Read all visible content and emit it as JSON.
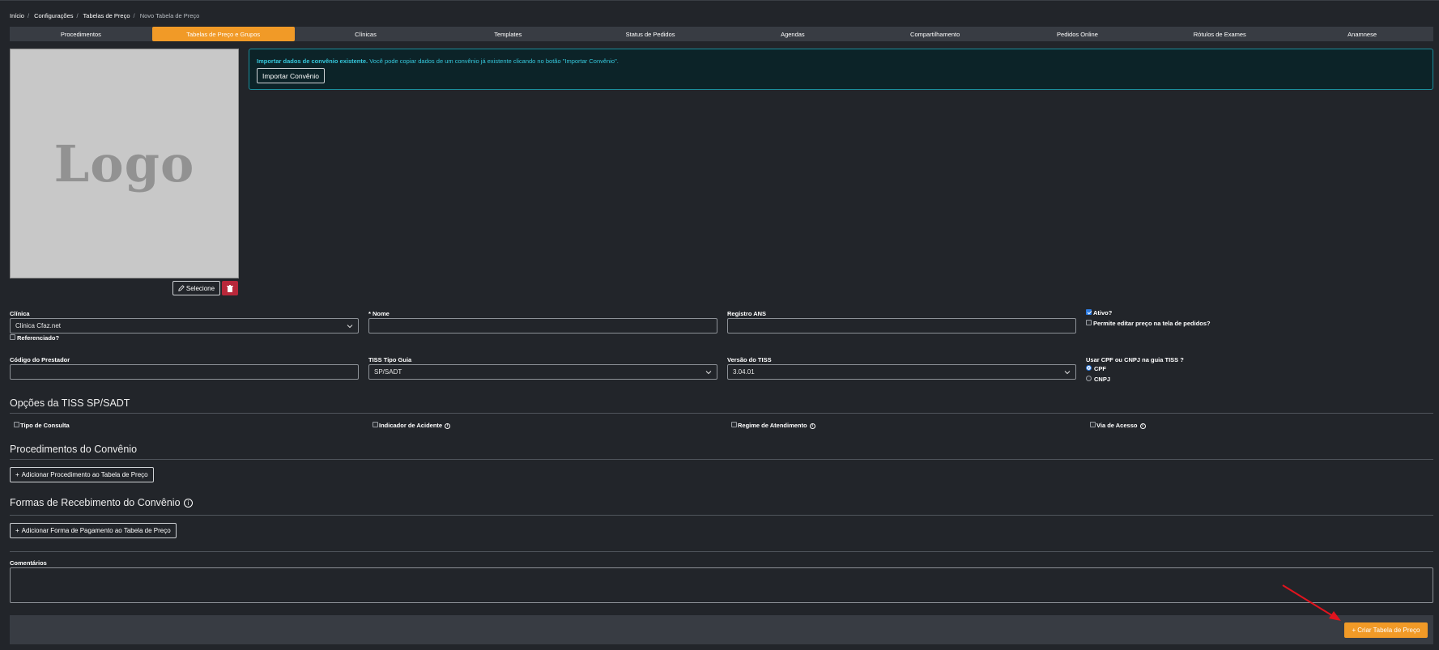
{
  "breadcrumb": {
    "items": [
      "Início",
      "Configurações",
      "Tabelas de Preço",
      "Novo Tabela de Preço"
    ]
  },
  "tabs": [
    {
      "label": "Procedimentos"
    },
    {
      "label": "Tabelas de Preço e Grupos"
    },
    {
      "label": "Clínicas"
    },
    {
      "label": "Templates"
    },
    {
      "label": "Status de Pedidos"
    },
    {
      "label": "Agendas"
    },
    {
      "label": "Compartilhamento"
    },
    {
      "label": "Pedidos Online"
    },
    {
      "label": "Rótulos de Exames"
    },
    {
      "label": "Anamnese"
    }
  ],
  "active_tab": "Tabelas de Preço e Grupos",
  "logo": {
    "placeholder_text": "Logo",
    "select_label": "Selecione"
  },
  "import_alert": {
    "bold_text": "Importar dados de convênio existente.",
    "text": " Você pode copiar dados de um convênio já existente clicando no botão \"Importar Convênio\".",
    "button_label": "Importar Convênio"
  },
  "form": {
    "clinica_label": "Clínica",
    "clinica_value": "Clinica Cfaz.net",
    "referenciado_label": "Referenciado?",
    "nome_required": "*",
    "nome_label": "Nome",
    "nome_value": "",
    "registro_ans_label": "Registro ANS",
    "registro_ans_value": "",
    "ativo_label": "Ativo?",
    "ativo_checked": true,
    "permite_editar_label": "Permite editar preço na tela de pedidos?",
    "codigo_prestador_label": "Código do Prestador",
    "codigo_prestador_value": "",
    "tiss_tipo_guia_label": "TISS Tipo Guia",
    "tiss_tipo_guia_value": "SP/SADT",
    "versao_tiss_label": "Versão do TISS",
    "versao_tiss_value": "3.04.01",
    "usar_cpf_cnpj_label": "Usar CPF ou CNPJ na guia TISS ?",
    "cpf_label": "CPF",
    "cnpj_label": "CNPJ",
    "selected_doc": "CPF"
  },
  "tiss_options": {
    "title": "Opções da TISS SP/SADT",
    "tipo_consulta": "Tipo de Consulta",
    "indicador_acidente": "Indicador de Acidente",
    "regime_atendimento": "Regime de Atendimento",
    "via_acesso": "Via de Acesso"
  },
  "procedimentos": {
    "title": "Procedimentos do Convênio",
    "add_button": "Adicionar Procedimento ao Tabela de Preço"
  },
  "formas": {
    "title": "Formas de Recebimento do Convênio",
    "add_button": "Adicionar Forma de Pagamento ao Tabela de Preço"
  },
  "comentarios": {
    "label": "Comentários",
    "value": ""
  },
  "footer": {
    "create_button": "Criar Tabela de Preço"
  },
  "colors": {
    "accent": "#f19a27",
    "background": "#22252a",
    "alert_text": "#36c8dc",
    "danger": "#b8283a",
    "annotation_arrow": "#e0141e"
  }
}
